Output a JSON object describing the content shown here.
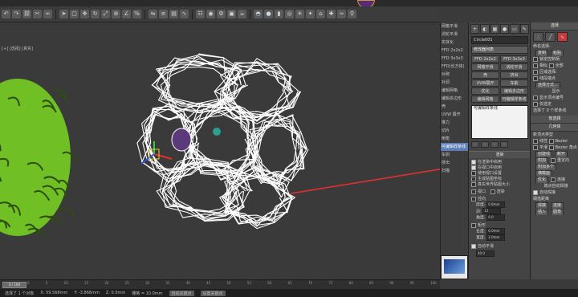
{
  "viewport": {
    "label": "[+] [透视] [真实]"
  },
  "toolbar": {
    "icons": [
      "undo-icon",
      "redo-icon",
      "link-icon",
      "unlink-icon",
      "bind-icon",
      "select-icon",
      "select-region-icon",
      "move-icon",
      "rotate-icon",
      "scale-icon",
      "snap-icon",
      "angle-snap-icon",
      "percent-snap-icon",
      "mirror-icon",
      "align-icon",
      "layer-icon",
      "curve-editor-icon",
      "schematic-icon",
      "material-editor-icon",
      "render-setup-icon",
      "render-frame-icon",
      "render-icon",
      "teapot-icon",
      "sphere-icon",
      "cylinder-icon",
      "torus-icon",
      "sun-icon",
      "light-icon",
      "camera-icon",
      "helper-icon",
      "space-warp-icon",
      "systems-icon"
    ]
  },
  "midcol": {
    "items": [
      "网格平滑",
      "涡轮平滑",
      "实体化",
      "FFD 2x2x2",
      "FFD 3x3x3",
      "FFD(长方体)",
      "对称",
      "补洞",
      "编辑网格",
      "编辑多边形",
      "壳",
      "UVW 展开",
      "推力",
      "切片",
      "倒角",
      "可编辑样条线",
      "车削",
      "挤出",
      "扫描"
    ],
    "selected_index": 15
  },
  "modpanel": {
    "tabs": [
      "+",
      "◐",
      "▦",
      "●",
      "▭",
      "✎"
    ],
    "name_field": "Circle001",
    "modifier_list": "修改器列表",
    "buttons": [
      "FFD 2x2x2",
      "FFD 3x3x3",
      "网格平滑",
      "涡轮平滑",
      "壳",
      "挤出",
      "UVW展开",
      "车削",
      "优化",
      "编辑多边形",
      "编辑网格",
      "可编辑样条线"
    ],
    "stack_item": "可编辑样条线",
    "rollout_render": "渲染",
    "render_opts": [
      "在渲染中启用",
      "在视口中启用",
      "使用视口设置",
      "生成贴图坐标",
      "真实世界贴图大小"
    ],
    "viewport_label": "视口",
    "render_label": "渲染",
    "radial_label": "径向",
    "thickness_label": "厚度:",
    "thickness_value": "0.8mm",
    "sides_label": "边:",
    "sides_value": "12",
    "angle_label": "角度:",
    "angle_value": "0.0",
    "rect_label": "矩形",
    "length_label": "长度:",
    "length_value": "6.0mm",
    "width_label": "宽度:",
    "width_value": "2.0mm",
    "auto_smooth": "自动平滑",
    "threshold_value": "40.0"
  },
  "rightpanel": {
    "select_head": "选择",
    "named_sel": "命名选择:",
    "copy": "复制",
    "paste": "粘贴",
    "lock": "锁定控制柄",
    "alike": "相似",
    "all": "全部",
    "area_sel": "区域选择:",
    "seg_end": "线段端点",
    "select_by": "选择方式...",
    "display": "显示",
    "show_vert_num": "显示顶点编号",
    "only_sel": "仅选定",
    "selected_count": "选择了 0 个样条线",
    "soft_sel": "软选择",
    "geometry": "几何体",
    "new_vertex_type": "新顶点类型",
    "linear": "线性",
    "bezier": "Bezier",
    "smooth": "平滑",
    "bezier_corner": "Bezier 角点",
    "create_line": "创建线",
    "break": "断开",
    "attach": "附加",
    "reorient": "重定向",
    "attach_mult": "附加多个",
    "cross_section": "横截面",
    "optimize": "优化",
    "connect": "连接",
    "endpoint_auto": "端点自动焊接",
    "auto_weld": "自动焊接",
    "threshold": "阈值距离",
    "weld": "焊接",
    "insert": "插入",
    "fillet": "圆角"
  },
  "status": {
    "selected": "选择了 1 个对象",
    "x": "X: 59.568mm",
    "y": "Y: -3.866mm",
    "z": "Z: 0.0mm",
    "grid": "栅格 = 10.0mm",
    "auto_key": "自动关键点",
    "set_key": "设置关键点"
  },
  "timeline": {
    "frame": "0 / 100",
    "ticks": [
      "0",
      "5",
      "10",
      "15",
      "20",
      "25",
      "30",
      "35",
      "40",
      "45",
      "50",
      "55",
      "60",
      "65",
      "70",
      "75",
      "80",
      "85",
      "90",
      "95",
      "100"
    ]
  },
  "colors": {
    "accent": "#5b7fb6",
    "arrow": "#e03030",
    "plant": "#7ccf2a",
    "spline": "#ffffff"
  }
}
